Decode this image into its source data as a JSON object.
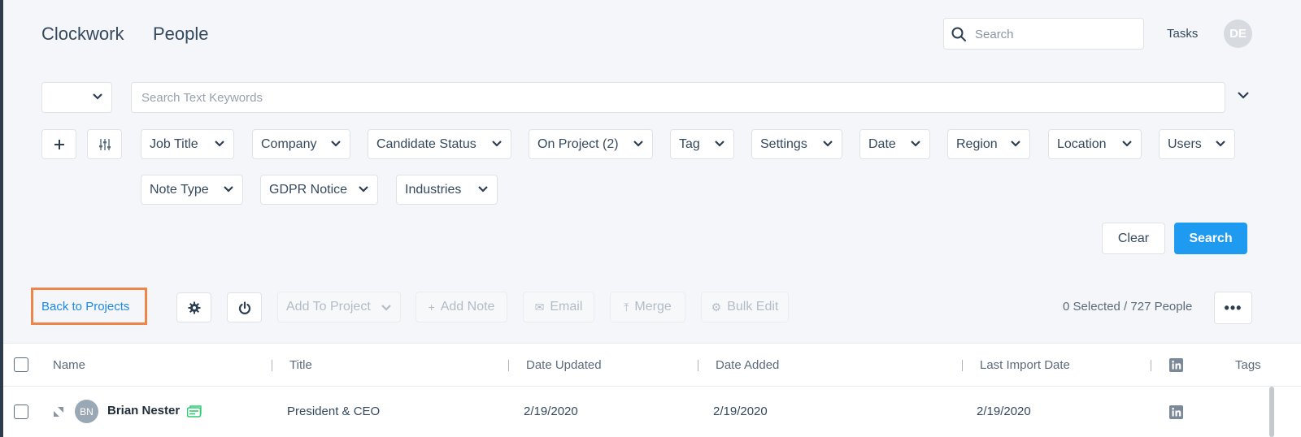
{
  "header": {
    "brand": "Clockwork",
    "section": "People",
    "search_placeholder": "Search",
    "tasks_label": "Tasks",
    "user_initials": "DE"
  },
  "keyword_search": {
    "mode_value": "",
    "placeholder": "Search Text Keywords"
  },
  "filters": [
    {
      "label": "Job Title"
    },
    {
      "label": "Company"
    },
    {
      "label": "Candidate Status"
    },
    {
      "label": "On Project (2)"
    },
    {
      "label": "Tag"
    },
    {
      "label": "Settings"
    },
    {
      "label": "Date"
    },
    {
      "label": "Region"
    },
    {
      "label": "Location"
    },
    {
      "label": "Users"
    },
    {
      "label": "Note Type"
    },
    {
      "label": "GDPR Notice"
    },
    {
      "label": "Industries"
    }
  ],
  "actions": {
    "clear_label": "Clear",
    "search_label": "Search"
  },
  "toolbar": {
    "back_label": "Back to Projects",
    "add_to_project": "Add To Project",
    "add_note": "Add Note",
    "email": "Email",
    "merge": "Merge",
    "bulk_edit": "Bulk Edit",
    "selection_count": "0 Selected / 727 People",
    "more_label": "•••"
  },
  "table": {
    "columns": [
      "Name",
      "Title",
      "Date Updated",
      "Date Added",
      "Last Import Date",
      "Tags"
    ],
    "rows": [
      {
        "initials": "BN",
        "name": "Brian Nester",
        "title": "President & CEO",
        "date_updated": "2/19/2020",
        "date_added": "2/19/2020",
        "last_import": "2/19/2020"
      }
    ]
  },
  "colors": {
    "primary": "#1e9af0",
    "highlight_border": "#f0854a",
    "link": "#1e88e5",
    "tag_icon": "#2ecc71"
  },
  "icons": {
    "search": "search-icon",
    "chevron": "chevron-down-icon",
    "plus": "plus-icon",
    "sliders": "sliders-icon",
    "gear": "gear-icon",
    "power": "power-icon",
    "linkedin": "linkedin-icon"
  }
}
